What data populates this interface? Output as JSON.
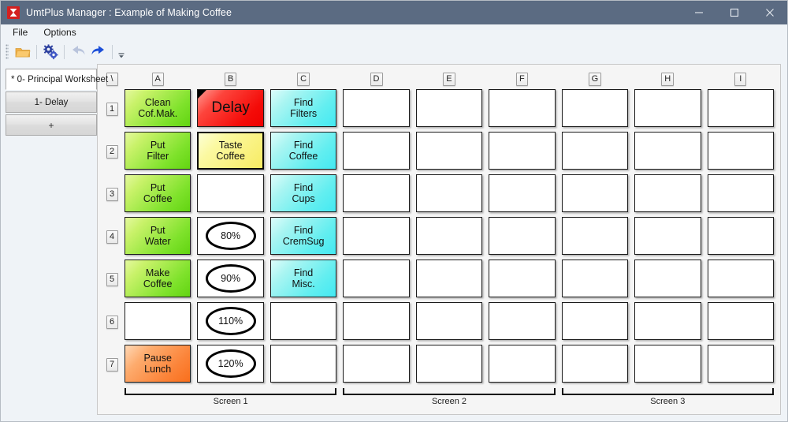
{
  "window": {
    "title": "UmtPlus Manager : Example of Making Coffee",
    "app_icon": "hourglass-icon",
    "controls": {
      "minimize": "minimize-icon",
      "maximize": "maximize-icon",
      "close": "close-icon"
    }
  },
  "menubar": {
    "items": [
      {
        "label": "File"
      },
      {
        "label": "Options"
      }
    ]
  },
  "toolbar": {
    "buttons": [
      {
        "name": "open-folder-icon",
        "title": "Open"
      },
      {
        "name": "settings-gears-icon",
        "title": "Settings"
      },
      {
        "name": "undo-icon",
        "title": "Undo",
        "disabled": true
      },
      {
        "name": "redo-icon",
        "title": "Redo",
        "disabled": false
      }
    ],
    "overflow": "toolbar-overflow-icon"
  },
  "sheet_tabs": {
    "items": [
      {
        "label": "* 0- Principal Worksheet",
        "active": true
      },
      {
        "label": "1- Delay",
        "active": false
      },
      {
        "label": "+",
        "active": false
      }
    ]
  },
  "grid": {
    "corner_label": "\\",
    "columns": [
      "A",
      "B",
      "C",
      "D",
      "E",
      "F",
      "G",
      "H",
      "I"
    ],
    "rows": [
      "1",
      "2",
      "3",
      "4",
      "5",
      "6",
      "7"
    ],
    "cells": [
      [
        {
          "text": "Clean\nCof.Mak.",
          "style": "green"
        },
        {
          "text": "Delay",
          "style": "red",
          "flag": true
        },
        {
          "text": "Find\nFilters",
          "style": "cyan"
        },
        {
          "text": "",
          "style": "plain"
        },
        {
          "text": "",
          "style": "plain"
        },
        {
          "text": "",
          "style": "plain"
        },
        {
          "text": "",
          "style": "plain"
        },
        {
          "text": "",
          "style": "plain"
        },
        {
          "text": "",
          "style": "plain"
        }
      ],
      [
        {
          "text": "Put\nFilter",
          "style": "green"
        },
        {
          "text": "Taste\nCoffee",
          "style": "yellow"
        },
        {
          "text": "Find\nCoffee",
          "style": "cyan"
        },
        {
          "text": "",
          "style": "plain"
        },
        {
          "text": "",
          "style": "plain"
        },
        {
          "text": "",
          "style": "plain"
        },
        {
          "text": "",
          "style": "plain"
        },
        {
          "text": "",
          "style": "plain"
        },
        {
          "text": "",
          "style": "plain"
        }
      ],
      [
        {
          "text": "Put\nCoffee",
          "style": "green"
        },
        {
          "text": "",
          "style": "plain"
        },
        {
          "text": "Find\nCups",
          "style": "cyan"
        },
        {
          "text": "",
          "style": "plain"
        },
        {
          "text": "",
          "style": "plain"
        },
        {
          "text": "",
          "style": "plain"
        },
        {
          "text": "",
          "style": "plain"
        },
        {
          "text": "",
          "style": "plain"
        },
        {
          "text": "",
          "style": "plain"
        }
      ],
      [
        {
          "text": "Put\nWater",
          "style": "green"
        },
        {
          "text": "80%",
          "style": "plain",
          "shape": "ellipse"
        },
        {
          "text": "Find\nCremSug",
          "style": "cyan"
        },
        {
          "text": "",
          "style": "plain"
        },
        {
          "text": "",
          "style": "plain"
        },
        {
          "text": "",
          "style": "plain"
        },
        {
          "text": "",
          "style": "plain"
        },
        {
          "text": "",
          "style": "plain"
        },
        {
          "text": "",
          "style": "plain"
        }
      ],
      [
        {
          "text": "Make\nCoffee",
          "style": "green"
        },
        {
          "text": "90%",
          "style": "plain",
          "shape": "ellipse"
        },
        {
          "text": "Find\nMisc.",
          "style": "cyan"
        },
        {
          "text": "",
          "style": "plain"
        },
        {
          "text": "",
          "style": "plain"
        },
        {
          "text": "",
          "style": "plain"
        },
        {
          "text": "",
          "style": "plain"
        },
        {
          "text": "",
          "style": "plain"
        },
        {
          "text": "",
          "style": "plain"
        }
      ],
      [
        {
          "text": "",
          "style": "plain"
        },
        {
          "text": "110%",
          "style": "plain",
          "shape": "ellipse"
        },
        {
          "text": "",
          "style": "plain"
        },
        {
          "text": "",
          "style": "plain"
        },
        {
          "text": "",
          "style": "plain"
        },
        {
          "text": "",
          "style": "plain"
        },
        {
          "text": "",
          "style": "plain"
        },
        {
          "text": "",
          "style": "plain"
        },
        {
          "text": "",
          "style": "plain"
        }
      ],
      [
        {
          "text": "Pause\nLunch",
          "style": "orange"
        },
        {
          "text": "120%",
          "style": "plain",
          "shape": "ellipse"
        },
        {
          "text": "",
          "style": "plain"
        },
        {
          "text": "",
          "style": "plain"
        },
        {
          "text": "",
          "style": "plain"
        },
        {
          "text": "",
          "style": "plain"
        },
        {
          "text": "",
          "style": "plain"
        },
        {
          "text": "",
          "style": "plain"
        },
        {
          "text": "",
          "style": "plain"
        }
      ]
    ],
    "screen_groups": [
      {
        "label": "Screen 1",
        "span": 3
      },
      {
        "label": "Screen 2",
        "span": 3
      },
      {
        "label": "Screen 3",
        "span": 3
      }
    ]
  },
  "colors": {
    "titlebar": "#5b6b82",
    "green": "#7ee22b",
    "red": "#f40b08",
    "cyan": "#62eef0",
    "yellow": "#f9f079",
    "orange": "#fb8338",
    "panel": "#eff3f7"
  }
}
